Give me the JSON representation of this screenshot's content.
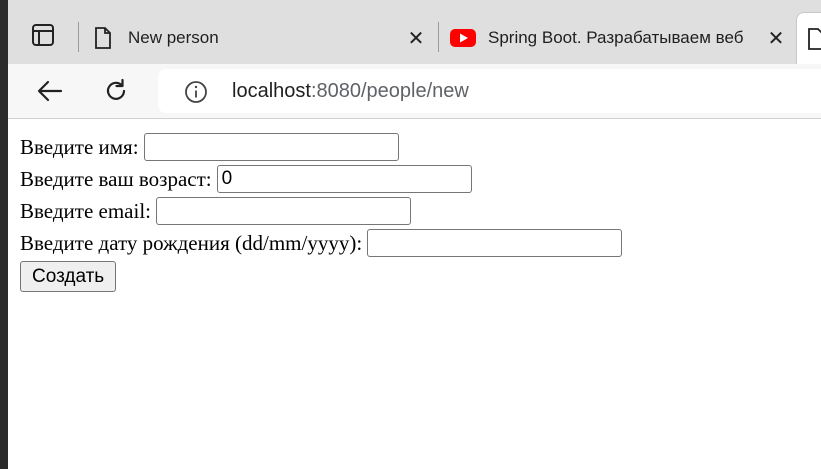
{
  "browser": {
    "tabs": [
      {
        "title": "New person",
        "icon": "page-icon",
        "active": false
      },
      {
        "title": "Spring Boot. Разрабатываем веб",
        "icon": "youtube-icon",
        "active": false
      }
    ],
    "close_glyph": "✕",
    "url": {
      "host": "localhost",
      "rest": ":8080/people/new"
    }
  },
  "form": {
    "name_label": "Введите имя:",
    "name_value": "",
    "age_label": "Введите ваш возраст:",
    "age_value": "0",
    "email_label": "Введите email:",
    "email_value": "",
    "birth_label": "Введите дату рождения (dd/mm/yyyy):",
    "birth_value": "",
    "submit_label": "Создать"
  },
  "colors": {
    "youtube_red": "#ff0000",
    "tabbar": "#dfdfdf",
    "toolbar": "#f7f7f7"
  }
}
